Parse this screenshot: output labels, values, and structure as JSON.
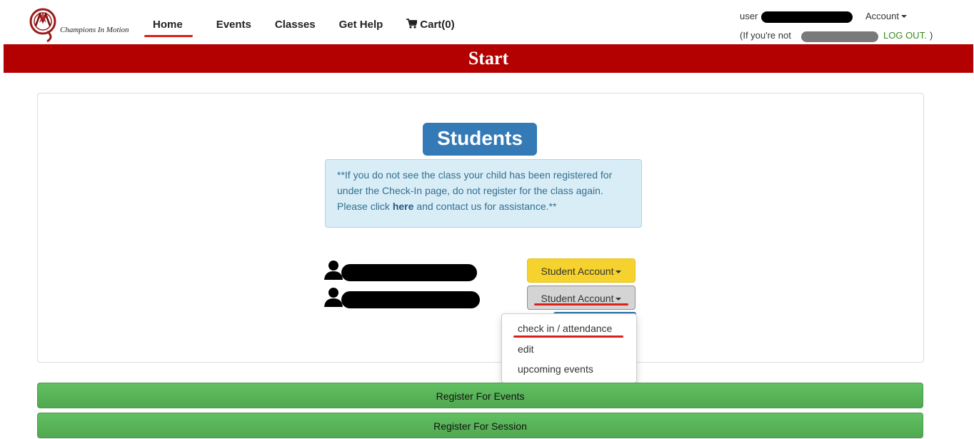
{
  "header": {
    "logo_text": "Champions In Motion",
    "nav": [
      {
        "label": "Home",
        "active": true
      },
      {
        "label": "Events"
      },
      {
        "label": "Classes"
      },
      {
        "label": "Get Help"
      },
      {
        "label": "Cart(0)",
        "icon": "cart-icon"
      }
    ],
    "user_label": "user",
    "account_label": "Account",
    "not_you_prefix": "(If you're not",
    "logout_label": "LOG OUT.",
    "not_you_suffix": ")"
  },
  "banner": {
    "title": "Start"
  },
  "students": {
    "heading": "Students",
    "notice_part1": "**If you do not see the class your child has been registered for under the Check-In page, do not register for the class again. Please click ",
    "notice_link": "here",
    "notice_part2": " and contact us for assistance.**",
    "rows": [
      {
        "button_label": "Student Account"
      },
      {
        "button_label": "Student Account"
      }
    ],
    "dropdown_items": [
      "check in / attendance",
      "edit",
      "upcoming events"
    ]
  },
  "actions": {
    "register_events": "Register For Events",
    "register_session": "Register For Session"
  },
  "colors": {
    "banner": "#b30000",
    "primary": "#337ab7",
    "warning": "#f5d22d",
    "success": "#5cb85c",
    "logout": "#3a8a1e"
  }
}
